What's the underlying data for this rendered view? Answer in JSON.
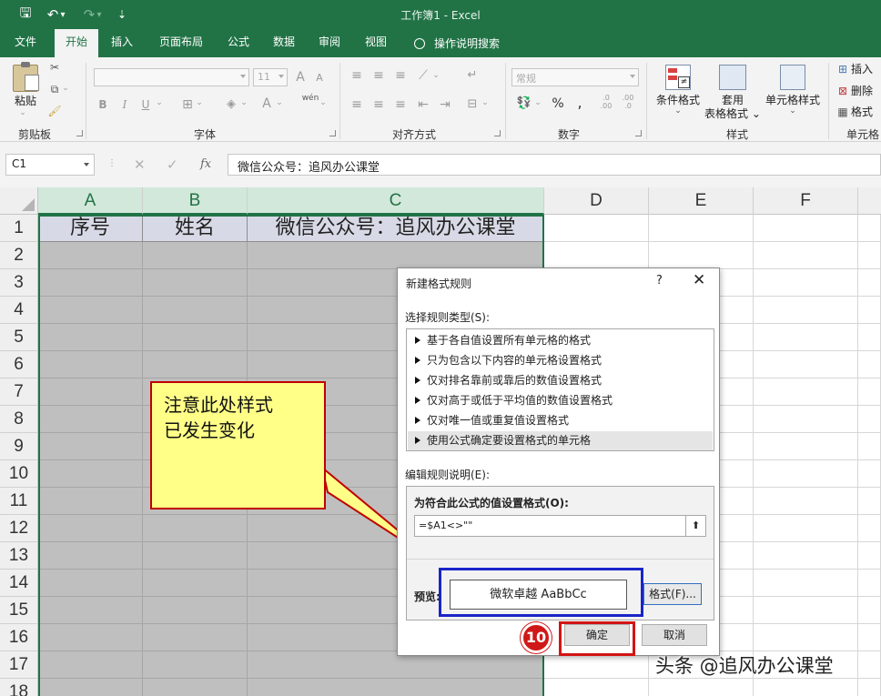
{
  "window": {
    "title": "工作簿1  -  Excel"
  },
  "quick_access": {
    "save": "🖫",
    "undo": "↶",
    "undo_dd": "▾",
    "redo": "↷",
    "redo_dd": "▾",
    "customize": "⇣"
  },
  "tabs": [
    {
      "label": "文件"
    },
    {
      "label": "开始"
    },
    {
      "label": "插入"
    },
    {
      "label": "页面布局"
    },
    {
      "label": "公式"
    },
    {
      "label": "数据"
    },
    {
      "label": "审阅"
    },
    {
      "label": "视图"
    }
  ],
  "tell_me": "操作说明搜索",
  "ribbon": {
    "clipboard": {
      "paste": "粘贴",
      "group": "剪贴板"
    },
    "font": {
      "font_name": "",
      "font_size": "11",
      "bold": "B",
      "italic": "I",
      "underline": "U",
      "grow": "A",
      "shrink": "A",
      "phonetic": "wén",
      "group": "字体"
    },
    "alignment": {
      "group": "对齐方式"
    },
    "number": {
      "format": "常规",
      "percent": "%",
      "comma": ",",
      "group": "数字"
    },
    "styles": {
      "conditional": "条件格式",
      "table_line1": "套用",
      "table_line2": "表格格式",
      "cell_styles": "单元格样式",
      "group": "样式"
    },
    "cells": {
      "insert": "插入",
      "delete": "删除",
      "format": "格式",
      "group": "单元格"
    }
  },
  "formula_bar": {
    "name_box": "C1",
    "cancel": "✕",
    "enter": "✓",
    "fx": "fx",
    "content": "微信公众号：追风办公课堂"
  },
  "columns": [
    "A",
    "B",
    "C",
    "D",
    "E",
    "F"
  ],
  "rows": [
    "1",
    "2",
    "3",
    "4",
    "5",
    "6",
    "7",
    "8",
    "9",
    "10",
    "11",
    "12",
    "13",
    "14",
    "15",
    "16",
    "17",
    "18"
  ],
  "cells": {
    "A1": "序号",
    "B1": "姓名",
    "C1": "微信公众号：追风办公课堂"
  },
  "callout": {
    "line1": "注意此处样式",
    "line2": "已发生变化"
  },
  "dialog": {
    "title": "新建格式规则",
    "help": "?",
    "close": "✕",
    "select_type_label": "选择规则类型(S):",
    "rule_types": [
      "基于各自值设置所有单元格的格式",
      "只为包含以下内容的单元格设置格式",
      "仅对排名靠前或靠后的数值设置格式",
      "仅对高于或低于平均值的数值设置格式",
      "仅对唯一值或重复值设置格式",
      "使用公式确定要设置格式的单元格"
    ],
    "selected_rule_index": 5,
    "edit_label": "编辑规则说明(E):",
    "formula_label": "为符合此公式的值设置格式(O):",
    "formula_value": "=$A1<>\"\"",
    "collapse_glyph": "⬆",
    "preview_label": "预览:",
    "preview_text": "微软卓越  AaBbCc",
    "format_button": "格式(F)...",
    "ok_button": "确定",
    "cancel_button": "取消"
  },
  "step_badge": "10",
  "watermark": "头条 @追风办公课堂",
  "colors": {
    "excel_green": "#217346",
    "callout_fill": "#ffff88",
    "callout_border": "#c00000",
    "highlight_blue": "#1a25c8",
    "highlight_red": "#d21414"
  }
}
